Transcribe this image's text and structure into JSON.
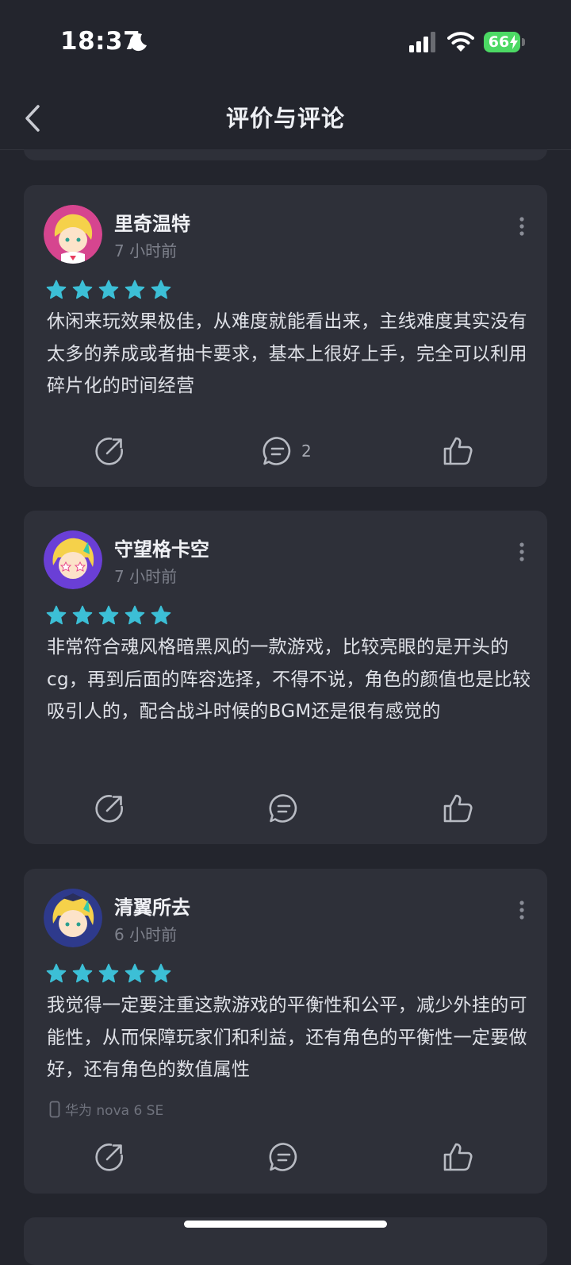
{
  "status_bar": {
    "time": "18:37",
    "battery": "66",
    "icons": [
      "moon-icon",
      "signal-icon",
      "wifi-icon",
      "battery-icon"
    ]
  },
  "nav": {
    "title": "评价与评论",
    "back_icon": "chevron-left-icon"
  },
  "reviews": [
    {
      "username": "里奇温特",
      "time": "7 小时前",
      "rating": 5,
      "text": "休闲来玩效果极佳，从难度就能看出来，主线难度其实没有太多的养成或者抽卡要求，基本上很好上手，完全可以利用碎片化的时间经营",
      "device": "",
      "comment_count": "2"
    },
    {
      "username": "守望格卡空",
      "time": "7 小时前",
      "rating": 5,
      "text": "非常符合魂风格暗黑风的一款游戏，比较亮眼的是开头的cg，再到后面的阵容选择，不得不说，角色的颜值也是比较吸引人的，配合战斗时候的BGM还是很有感觉的",
      "device": "",
      "comment_count": ""
    },
    {
      "username": "清翼所去",
      "time": "6 小时前",
      "rating": 5,
      "text": "我觉得一定要注重这款游戏的平衡性和公平，减少外挂的可能性，从而保障玩家们和利益，还有角色的平衡性一定要做好，还有角色的数值属性",
      "device": "华为 nova 6 SE",
      "comment_count": ""
    }
  ],
  "colors": {
    "background": "#23252d",
    "card": "#2e3039",
    "star": "#3cbfd6",
    "battery": "#4cd964"
  }
}
